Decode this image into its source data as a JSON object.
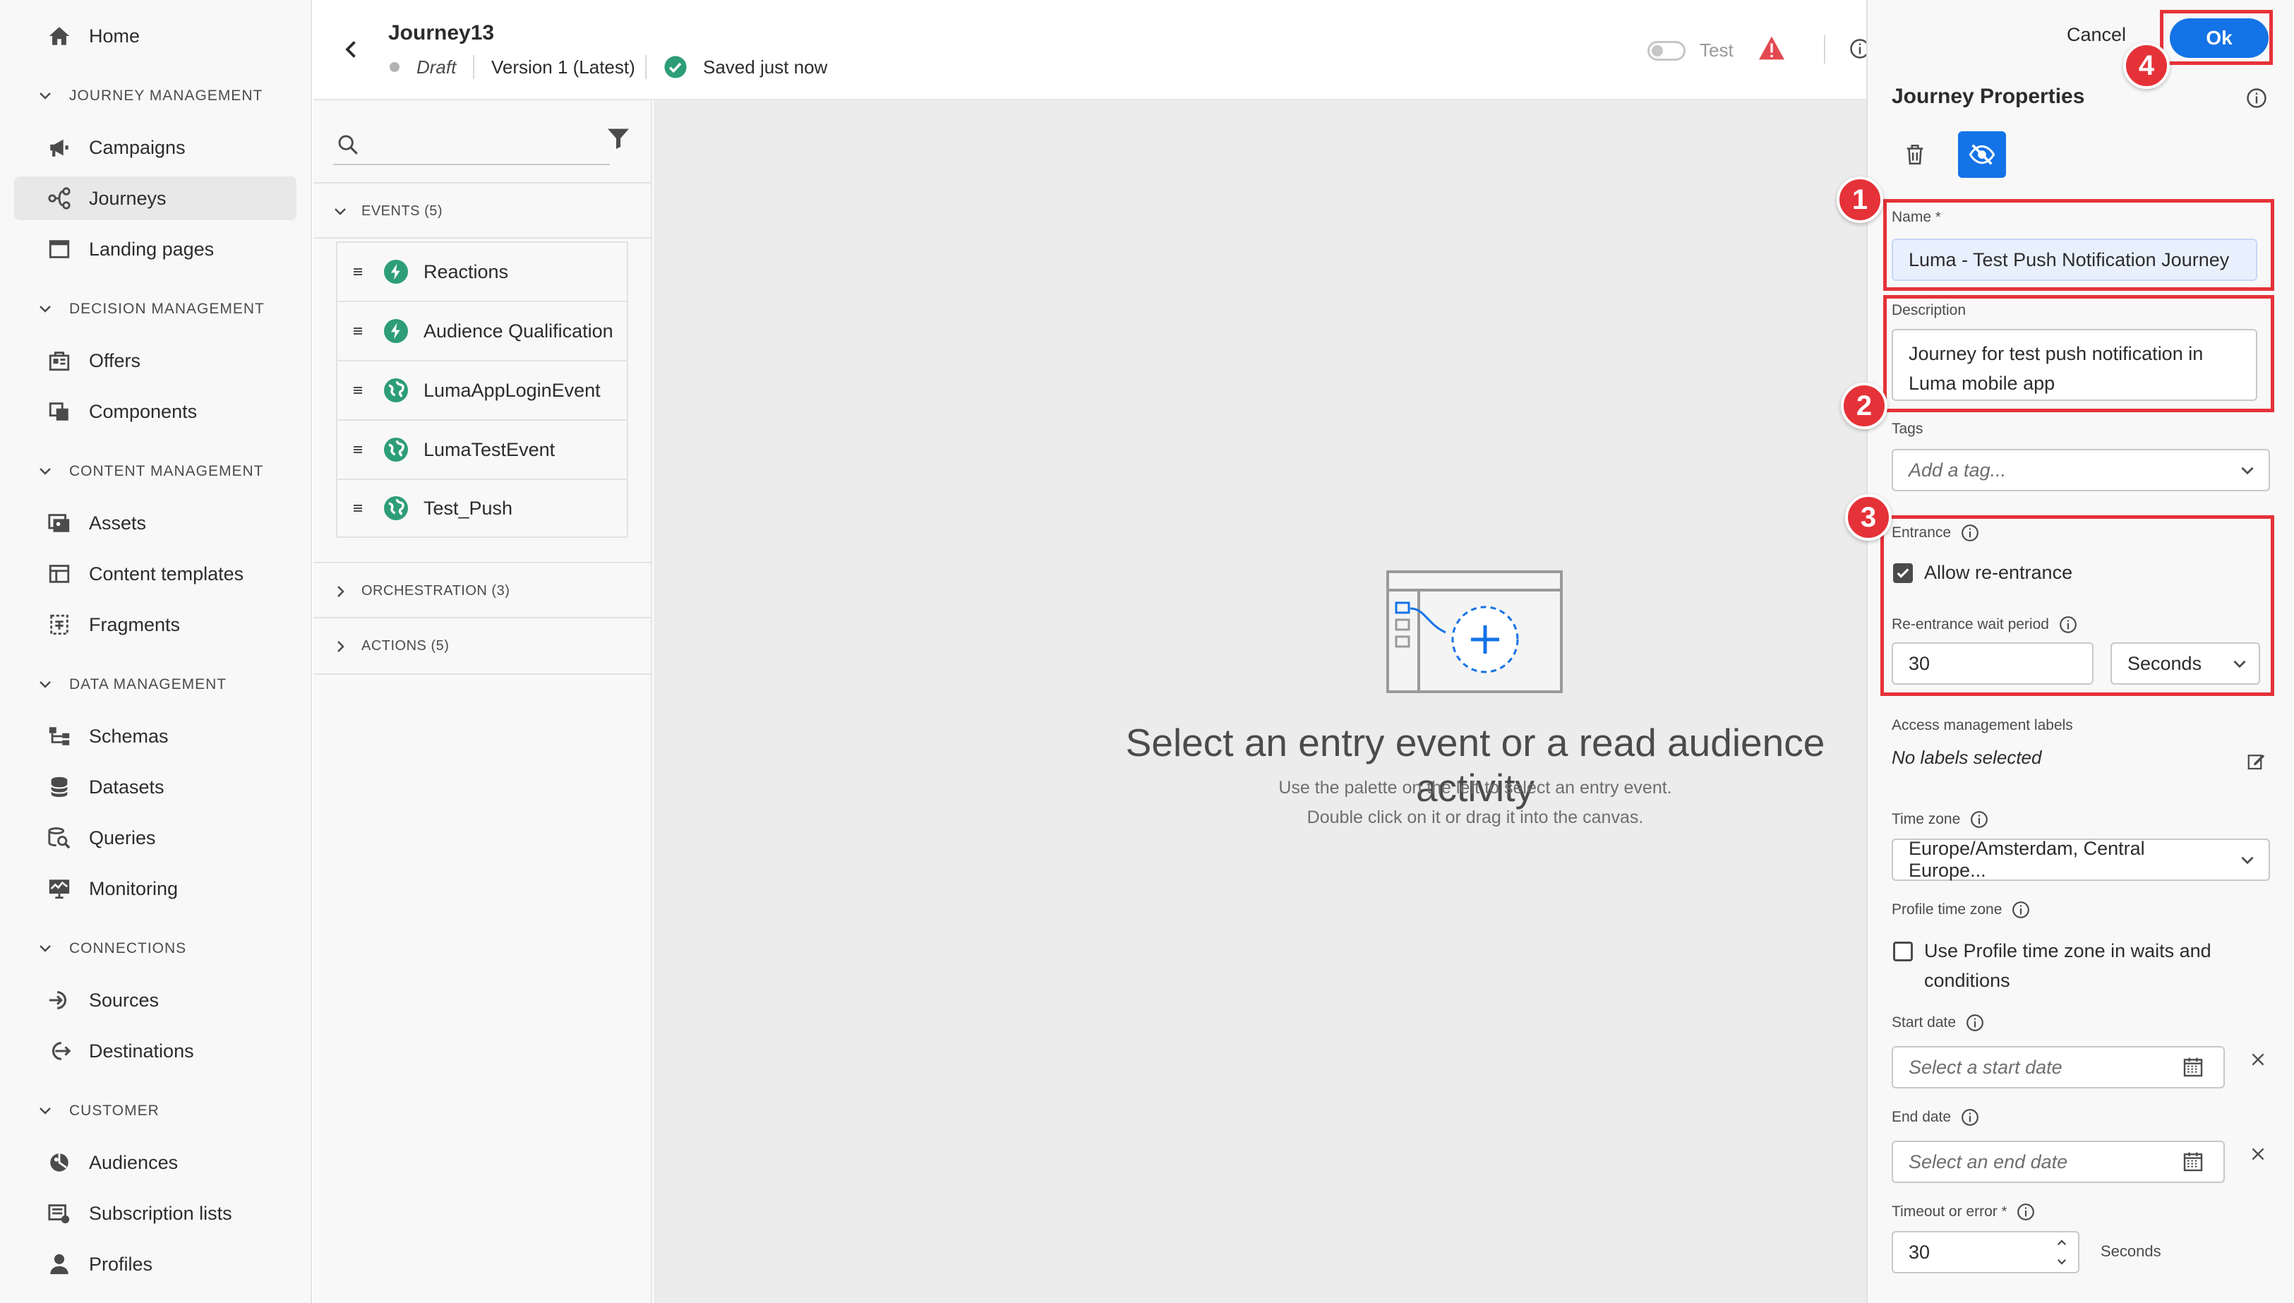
{
  "nav": {
    "home": "Home",
    "sections": [
      {
        "label": "JOURNEY MANAGEMENT",
        "items": [
          "Campaigns",
          "Journeys",
          "Landing pages"
        ]
      },
      {
        "label": "DECISION MANAGEMENT",
        "items": [
          "Offers",
          "Components"
        ]
      },
      {
        "label": "CONTENT MANAGEMENT",
        "items": [
          "Assets",
          "Content templates",
          "Fragments"
        ]
      },
      {
        "label": "DATA MANAGEMENT",
        "items": [
          "Schemas",
          "Datasets",
          "Queries",
          "Monitoring"
        ]
      },
      {
        "label": "CONNECTIONS",
        "items": [
          "Sources",
          "Destinations"
        ]
      },
      {
        "label": "CUSTOMER",
        "items": [
          "Audiences",
          "Subscription lists",
          "Profiles"
        ]
      }
    ],
    "selected": "Journeys"
  },
  "header": {
    "title": "Journey13",
    "status": "Draft",
    "version": "Version 1 (Latest)",
    "saved": "Saved just now",
    "test_label": "Test"
  },
  "palette": {
    "search_placeholder": "",
    "events_label": "EVENTS (5)",
    "events": [
      "Reactions",
      "Audience Qualification",
      "LumaAppLoginEvent",
      "LumaTestEvent",
      "Test_Push"
    ],
    "orchestration_label": "ORCHESTRATION (3)",
    "actions_label": "ACTIONS (5)"
  },
  "canvas": {
    "title": "Select an entry event or a read audience activity",
    "line1": "Use the palette on the left to select an entry event.",
    "line2": "Double click on it or drag it into the canvas."
  },
  "panel": {
    "cancel": "Cancel",
    "ok": "Ok",
    "title": "Journey Properties",
    "name_label": "Name",
    "required_mark": "*",
    "name_value": "Luma - Test Push Notification Journey",
    "description_label": "Description",
    "description_value": "Journey for test push notification in Luma mobile app",
    "tags_label": "Tags",
    "tags_placeholder": "Add a tag...",
    "entrance_label": "Entrance",
    "allow_reentrance": "Allow re-entrance",
    "allow_reentrance_checked": true,
    "wait_period_label": "Re-entrance wait period",
    "wait_period_value": "30",
    "wait_period_unit": "Seconds",
    "access_label": "Access management labels",
    "access_value": "No labels selected",
    "timezone_label": "Time zone",
    "timezone_value": "Europe/Amsterdam, Central Europe...",
    "profile_tz_label": "Profile time zone",
    "profile_tz_option": "Use Profile time zone in waits and conditions",
    "profile_tz_checked": false,
    "start_label": "Start date",
    "start_placeholder": "Select a start date",
    "end_label": "End date",
    "end_placeholder": "Select an end date",
    "timeout_label": "Timeout or error",
    "timeout_value": "30",
    "timeout_unit": "Seconds"
  },
  "annotations": [
    "1",
    "2",
    "3",
    "4"
  ],
  "colors": {
    "accent": "#1473e6",
    "annotation_red": "#e53238",
    "event_green": "#2d9d78",
    "canvas_bg": "#ececec"
  }
}
